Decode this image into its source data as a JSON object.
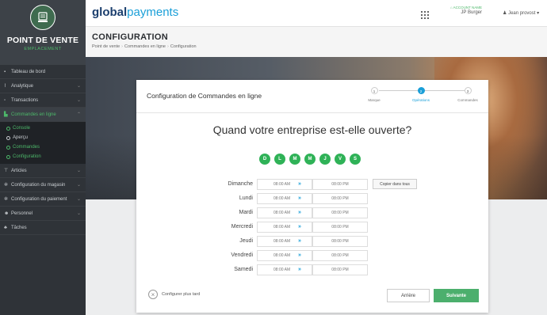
{
  "sidebar": {
    "brand_title": "POINT DE VENTE",
    "brand_subtitle": "EMPLACEMENT",
    "items": [
      {
        "label": "Tableau de bord",
        "icon": "dashboard-icon"
      },
      {
        "label": "Analytique",
        "icon": "chart-icon"
      },
      {
        "label": "Transactions",
        "icon": "transactions-icon"
      },
      {
        "label": "Commandes en ligne",
        "icon": "cart-icon"
      },
      {
        "label": "Articles",
        "icon": "tag-icon"
      },
      {
        "label": "Configuration du magasin",
        "icon": "settings-icon"
      },
      {
        "label": "Configuration du paiement",
        "icon": "settings-icon"
      },
      {
        "label": "Personnel",
        "icon": "people-icon"
      },
      {
        "label": "Tâches",
        "icon": "tasks-icon"
      }
    ],
    "sub_items": [
      {
        "label": "Console"
      },
      {
        "label": "Aperçu"
      },
      {
        "label": "Commandes"
      },
      {
        "label": "Configuration"
      }
    ]
  },
  "topbar": {
    "logo_bold": "global",
    "logo_light": "payments",
    "account_label": "ACCOUNT NAME",
    "account_name": "JP Burger",
    "user_name": "Jean provost"
  },
  "page": {
    "title": "CONFIGURATION",
    "breadcrumb": [
      "Point de vente",
      "Commandes en ligne",
      "Configuration"
    ]
  },
  "modal": {
    "title": "Configuration de Commandes en ligne",
    "steps": [
      {
        "num": "1",
        "label": "Marque"
      },
      {
        "num": "2",
        "label": "Opérations"
      },
      {
        "num": "3",
        "label": "Commandes"
      }
    ],
    "question": "Quand votre entreprise est-elle ouverte?",
    "day_letters": [
      "D",
      "L",
      "M",
      "M",
      "J",
      "V",
      "S"
    ],
    "schedule": [
      {
        "day": "Dimanche",
        "from": "08:00 AM",
        "to": "08:00 PM"
      },
      {
        "day": "Lundi",
        "from": "08:00 AM",
        "to": "08:00 PM"
      },
      {
        "day": "Mardi",
        "from": "08:00 AM",
        "to": "08:00 PM"
      },
      {
        "day": "Mercredi",
        "from": "08:00 AM",
        "to": "08:00 PM"
      },
      {
        "day": "Jeudi",
        "from": "08:00 AM",
        "to": "08:00 PM"
      },
      {
        "day": "Vendredi",
        "from": "08:00 AM",
        "to": "08:00 PM"
      },
      {
        "day": "Samedi",
        "from": "08:00 AM",
        "to": "08:00 PM"
      }
    ],
    "copy_label": "Copier dans tous",
    "later_label": "Configurer plus tard",
    "back_label": "Arrière",
    "next_label": "Suivante"
  },
  "colors": {
    "accent_green": "#2fb257",
    "accent_blue": "#1a9fd8",
    "sidebar_bg": "#2f3338"
  }
}
